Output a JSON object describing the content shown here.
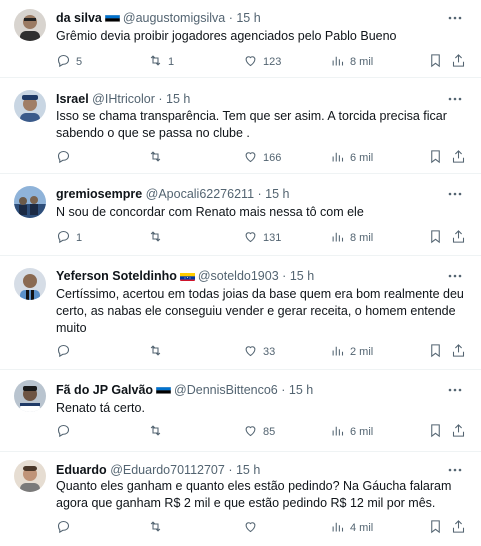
{
  "tweets": [
    {
      "name": "da silva",
      "flag": "estonia",
      "handle": "@augustomigsilva",
      "dot": "·",
      "time": "15 h",
      "text": "Grêmio devia proibir jogadores agenciados pelo Pablo Bueno",
      "replies": "5",
      "retweets": "1",
      "likes": "123",
      "views": "8 mil"
    },
    {
      "name": "Israel",
      "flag": "",
      "handle": "@IHtricolor",
      "dot": "·",
      "time": "15 h",
      "text": "Isso se chama transparência. Tem que ser asim. A torcida precisa ficar sabendo o que se passa no clube .",
      "replies": "",
      "retweets": "",
      "likes": "166",
      "views": "6 mil"
    },
    {
      "name": "gremiosempre",
      "flag": "",
      "handle": "@Apocali62276211",
      "dot": "·",
      "time": "15 h",
      "text": "N sou de concordar com Renato mais nessa tô com ele",
      "replies": "1",
      "retweets": "",
      "likes": "131",
      "views": "8 mil"
    },
    {
      "name": "Yeferson Soteldinho",
      "flag": "venezuela",
      "handle": "@soteldo1903",
      "dot": "·",
      "time": "15 h",
      "text": "Certíssimo, acertou em todas joias da base quem era bom realmente deu certo, as nabas ele conseguiu vender e gerar receita, o homem entende muito",
      "replies": "",
      "retweets": "",
      "likes": "33",
      "views": "2 mil"
    },
    {
      "name": "Fã do JP Galvão",
      "flag": "estonia",
      "handle": "@DennisBittenco6",
      "dot": "·",
      "time": "15 h",
      "text": "Renato tá certo.",
      "replies": "",
      "retweets": "",
      "likes": "85",
      "views": "6 mil"
    },
    {
      "name": "Eduardo",
      "flag": "",
      "handle": "@Eduardo70112707",
      "dot": "·",
      "time": "15 h",
      "text": "Quanto eles ganham e quanto eles estão pedindo? Na Gáucha falaram agora que ganham R$ 2 mil e que estão pedindo R$ 12 mil por mês.",
      "replies": "",
      "retweets": "",
      "likes": "",
      "views": "4 mil"
    }
  ],
  "icons": {
    "reply": "reply-icon",
    "retweet": "retweet-icon",
    "like": "heart-icon",
    "views": "views-icon",
    "bookmark": "bookmark-icon",
    "share": "share-icon",
    "more": "more-icon"
  },
  "colors": {
    "secondary_text": "#536471",
    "divider": "#eff3f4"
  }
}
